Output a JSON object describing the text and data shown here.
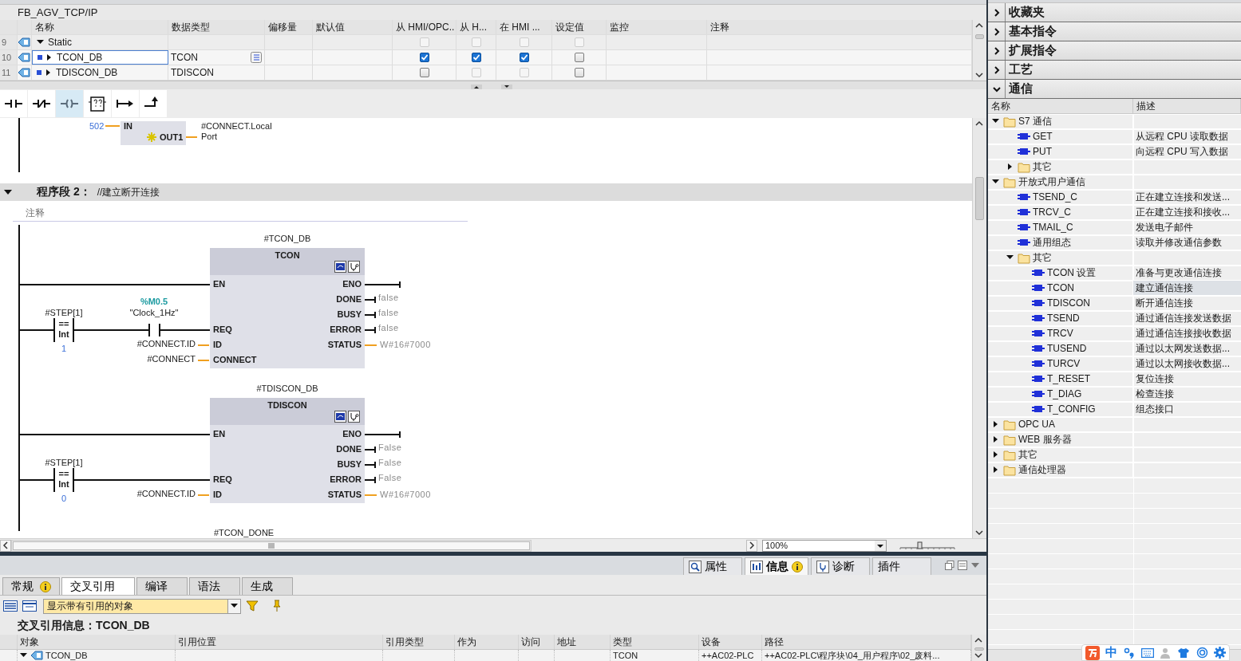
{
  "editor": {
    "title": "FB_AGV_TCP/IP",
    "interface": {
      "columns": [
        "名称",
        "数据类型",
        "偏移量",
        "默认值",
        "从 HMI/OPC..",
        "从 H...",
        "在 HMI ...",
        "设定值",
        "监控",
        "注释"
      ],
      "rows": [
        {
          "number": "9",
          "kind": "section",
          "name": "Static",
          "expanded": true,
          "selected": false,
          "checks": [
            {
              "checked": false,
              "disabled": true
            },
            {
              "checked": false,
              "disabled": true
            },
            {
              "checked": false,
              "disabled": true
            },
            {
              "checked": false,
              "disabled": true
            }
          ]
        },
        {
          "number": "10",
          "kind": "member",
          "name": "TCON_DB",
          "data_type": "TCON",
          "expanded": false,
          "selected": true,
          "checks": [
            {
              "checked": true,
              "disabled": false
            },
            {
              "checked": true,
              "disabled": false
            },
            {
              "checked": true,
              "disabled": false
            },
            {
              "checked": false,
              "disabled": false
            }
          ]
        },
        {
          "number": "11",
          "kind": "member",
          "name": "TDISCON_DB",
          "data_type": "TDISCON",
          "expanded": false,
          "selected": false,
          "checks": [
            {
              "checked": false,
              "disabled": false
            },
            {
              "checked": false,
              "disabled": true
            },
            {
              "checked": false,
              "disabled": true
            },
            {
              "checked": false,
              "disabled": false
            }
          ]
        }
      ]
    },
    "toolbar": [
      {
        "kind": "no-contact",
        "selected": false
      },
      {
        "kind": "nc-contact",
        "selected": false
      },
      {
        "kind": "coil",
        "selected": true
      },
      {
        "kind": "box",
        "selected": false
      },
      {
        "kind": "open-branch",
        "selected": false
      },
      {
        "kind": "close-branch",
        "selected": false
      }
    ],
    "network": {
      "previous": {
        "input_pin": "IN",
        "input_operand": "502",
        "output_pin": "OUT1",
        "output_operand_lines": [
          "#CONNECT.Local",
          "Port"
        ]
      },
      "number_label": "程序段 2：",
      "title": "//建立断开连接",
      "expanded": true,
      "comment_placeholder": "注释",
      "rungs": [
        {
          "instance": "#TCON_DB",
          "block": "TCON",
          "compare": {
            "operand": "#STEP[1]",
            "operator": "==",
            "type": "Int",
            "value": "1"
          },
          "contact": {
            "address": "%M0.5",
            "symbol": "\"Clock_1Hz\""
          },
          "inputs": [
            {
              "pin": "EN",
              "kind": "enable"
            },
            {
              "pin": "REQ",
              "kind": "logic"
            },
            {
              "pin": "ID",
              "kind": "operand",
              "operand": "#CONNECT.ID"
            },
            {
              "pin": "CONNECT",
              "kind": "operand",
              "operand": "#CONNECT"
            }
          ],
          "outputs": [
            {
              "pin": "ENO",
              "kind": "enable"
            },
            {
              "pin": "DONE",
              "kind": "bool",
              "value": "false"
            },
            {
              "pin": "BUSY",
              "kind": "bool",
              "value": "false"
            },
            {
              "pin": "ERROR",
              "kind": "bool",
              "value": "false"
            },
            {
              "pin": "STATUS",
              "kind": "word",
              "value": "W#16#7000"
            }
          ]
        },
        {
          "instance": "#TDISCON_DB",
          "block": "TDISCON",
          "compare": {
            "operand": "#STEP[1]",
            "operator": "==",
            "type": "Int",
            "value": "0"
          },
          "inputs": [
            {
              "pin": "EN",
              "kind": "enable"
            },
            {
              "pin": "REQ",
              "kind": "logic"
            },
            {
              "pin": "ID",
              "kind": "operand",
              "operand": "#CONNECT.ID"
            }
          ],
          "outputs": [
            {
              "pin": "ENO",
              "kind": "enable"
            },
            {
              "pin": "DONE",
              "kind": "bool",
              "value": "False"
            },
            {
              "pin": "BUSY",
              "kind": "bool",
              "value": "False"
            },
            {
              "pin": "ERROR",
              "kind": "bool",
              "value": "False"
            },
            {
              "pin": "STATUS",
              "kind": "word",
              "value": "W#16#7000"
            }
          ]
        }
      ],
      "next_label": "#TCON_DONE"
    },
    "zoom": "100%",
    "zoom_slider": {
      "level": 0.35
    }
  },
  "inspector": {
    "tabs": [
      {
        "label": "属性",
        "kind": "properties",
        "selected": false,
        "badge": false
      },
      {
        "label": "信息",
        "kind": "info",
        "selected": true,
        "badge": true
      },
      {
        "label": "诊断",
        "kind": "diagnostics",
        "selected": false,
        "badge": false
      },
      {
        "label": "插件",
        "kind": "plugins",
        "selected": false,
        "badge": false
      }
    ],
    "subtabs": [
      {
        "label": "常规",
        "selected": false,
        "badge": true
      },
      {
        "label": "交叉引用",
        "selected": true,
        "badge": false
      },
      {
        "label": "编译",
        "selected": false,
        "badge": false
      },
      {
        "label": "语法",
        "selected": false,
        "badge": false
      },
      {
        "label": "生成",
        "selected": false,
        "badge": false
      }
    ],
    "filter": {
      "value": "显示带有引用的对象"
    },
    "heading": "交叉引用信息：TCON_DB",
    "table": {
      "columns": [
        "对象",
        "引用位置",
        "引用类型",
        "作为",
        "访问",
        "地址",
        "类型",
        "设备",
        "路径"
      ],
      "rows": [
        {
          "object": "TCON_DB",
          "expanded": true,
          "type": "TCON",
          "device": "++AC02-PLC",
          "path": "++AC02-PLC\\程序块\\04_用户程序\\02_废料..."
        }
      ]
    }
  },
  "instructions": {
    "sections": [
      {
        "label": "收藏夹",
        "expanded": false
      },
      {
        "label": "基本指令",
        "expanded": false
      },
      {
        "label": "扩展指令",
        "expanded": false
      },
      {
        "label": "工艺",
        "expanded": false
      },
      {
        "label": "通信",
        "expanded": true
      }
    ],
    "tree": {
      "columns": [
        "名称",
        "描述"
      ],
      "items": [
        {
          "label": "S7 通信",
          "kind": "folder",
          "expanded": true,
          "selected": false,
          "children": [
            {
              "label": "GET",
              "kind": "instruction",
              "description": "从远程 CPU 读取数据",
              "selected": false
            },
            {
              "label": "PUT",
              "kind": "instruction",
              "description": "向远程 CPU 写入数据",
              "selected": false
            },
            {
              "label": "其它",
              "kind": "folder",
              "expanded": false,
              "selected": false
            }
          ]
        },
        {
          "label": "开放式用户通信",
          "kind": "folder",
          "expanded": true,
          "selected": false,
          "children": [
            {
              "label": "TSEND_C",
              "kind": "instruction",
              "description": "正在建立连接和发送...",
              "selected": false
            },
            {
              "label": "TRCV_C",
              "kind": "instruction",
              "description": "正在建立连接和接收...",
              "selected": false
            },
            {
              "label": "TMAIL_C",
              "kind": "instruction",
              "description": "发送电子邮件",
              "selected": false
            },
            {
              "label": "通用组态",
              "kind": "instruction",
              "description": "读取并修改通信参数",
              "selected": false
            },
            {
              "label": "其它",
              "kind": "folder",
              "expanded": true,
              "selected": false,
              "children": [
                {
                  "label": "TCON 设置",
                  "kind": "instruction",
                  "description": "准备与更改通信连接",
                  "selected": false
                },
                {
                  "label": "TCON",
                  "kind": "instruction",
                  "description": "建立通信连接",
                  "selected": true
                },
                {
                  "label": "TDISCON",
                  "kind": "instruction",
                  "description": "断开通信连接",
                  "selected": false
                },
                {
                  "label": "TSEND",
                  "kind": "instruction",
                  "description": "通过通信连接发送数据",
                  "selected": false
                },
                {
                  "label": "TRCV",
                  "kind": "instruction",
                  "description": "通过通信连接接收数据",
                  "selected": false
                },
                {
                  "label": "TUSEND",
                  "kind": "instruction",
                  "description": "通过以太网发送数据...",
                  "selected": false
                },
                {
                  "label": "TURCV",
                  "kind": "instruction",
                  "description": "通过以太网接收数据...",
                  "selected": false
                },
                {
                  "label": "T_RESET",
                  "kind": "instruction",
                  "description": "复位连接",
                  "selected": false
                },
                {
                  "label": "T_DIAG",
                  "kind": "instruction",
                  "description": "检查连接",
                  "selected": false
                },
                {
                  "label": "T_CONFIG",
                  "kind": "instruction",
                  "description": "组态接口",
                  "selected": false
                }
              ]
            }
          ]
        },
        {
          "label": "OPC UA",
          "kind": "folder",
          "expanded": false,
          "selected": false
        },
        {
          "label": "WEB 服务器",
          "kind": "folder",
          "expanded": false,
          "selected": false
        },
        {
          "label": "其它",
          "kind": "folder",
          "expanded": false,
          "selected": false
        },
        {
          "label": "通信处理器",
          "kind": "folder",
          "expanded": false,
          "selected": false
        }
      ]
    }
  },
  "ime_toolbar": {
    "mode": "中"
  }
}
